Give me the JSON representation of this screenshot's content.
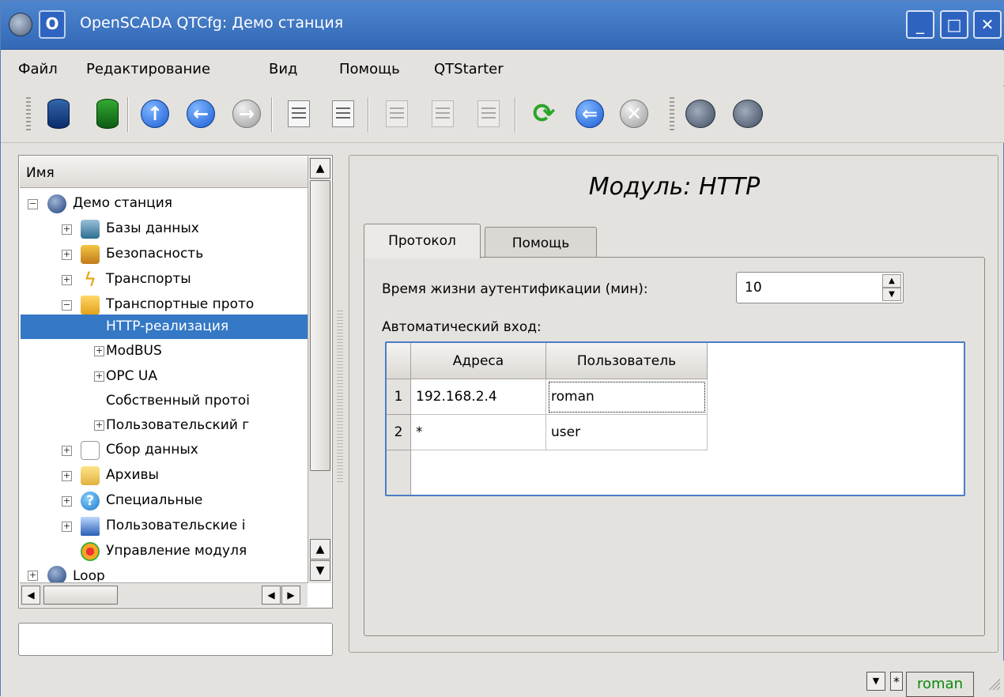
{
  "window": {
    "title": "OpenSCADA QTCfg: Демо станция",
    "menu_icon": "O",
    "min": "_",
    "max": "□",
    "close": "✕"
  },
  "menu": {
    "file": "Файл",
    "edit": "Редактирование",
    "view": "Вид",
    "help": "Помощь",
    "qtstarter": "QTStarter"
  },
  "toolbar": {
    "icons": [
      "db-load-icon",
      "db-save-icon",
      "up-icon",
      "back-icon",
      "forward-icon",
      "add-item-icon",
      "delete-item-icon",
      "copy-icon",
      "cut-icon",
      "paste-icon",
      "refresh-icon",
      "start-icon",
      "stop-icon",
      "qtcfg-icon",
      "uicfg-icon"
    ]
  },
  "tree": {
    "header": "Имя",
    "items": [
      {
        "label": "Демо станция",
        "icon": "station-icon"
      },
      {
        "label": "Базы данных",
        "icon": "database-icon"
      },
      {
        "label": "Безопасность",
        "icon": "security-icon"
      },
      {
        "label": "Транспорты",
        "icon": "transport-icon"
      },
      {
        "label": "Транспортные прото",
        "icon": "folder-icon"
      },
      {
        "label": "HTTP-реализация",
        "icon": ""
      },
      {
        "label": "ModBUS",
        "icon": ""
      },
      {
        "label": "OPC UA",
        "icon": ""
      },
      {
        "label": "Собственный протоі",
        "icon": ""
      },
      {
        "label": "Пользовательский г",
        "icon": ""
      },
      {
        "label": "Сбор данных",
        "icon": "daq-icon"
      },
      {
        "label": "Архивы",
        "icon": "archive-icon"
      },
      {
        "label": "Специальные",
        "icon": "special-icon"
      },
      {
        "label": "Пользовательские і",
        "icon": "ui-icon"
      },
      {
        "label": "Управление модуля",
        "icon": "modules-icon"
      },
      {
        "label": "Loop",
        "icon": "station-icon"
      }
    ]
  },
  "page": {
    "title": "Модуль: HTTP",
    "tabs": [
      "Протокол",
      "Помощь"
    ],
    "auth_label": "Время жизни аутентификации (мин):",
    "auth_value": "10",
    "autologin_label": "Автоматический вход:",
    "table": {
      "columns": [
        "Адреса",
        "Пользователь"
      ],
      "rows": [
        {
          "n": "1",
          "address": "192.168.2.4",
          "user": "roman"
        },
        {
          "n": "2",
          "address": "*",
          "user": "user"
        }
      ]
    }
  },
  "statusbar": {
    "star": "*",
    "user": "roman"
  },
  "colors": {
    "titlebar": "#3a72c2",
    "selection": "#3478c6",
    "user_text": "#0a8a0a"
  }
}
